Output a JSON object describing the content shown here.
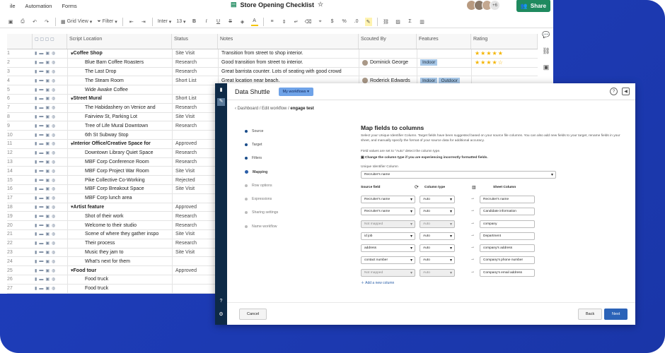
{
  "menu": {
    "items": [
      "ile",
      "Automation",
      "Forms"
    ]
  },
  "sheet": {
    "title": "Store Opening Checklist",
    "share": "Share",
    "more_avatars": "+6",
    "toolbar": {
      "grid_view": "Grid View",
      "filter": "Filter",
      "font": "Inter",
      "size": "13"
    },
    "columns": {
      "script": "Script Location",
      "status": "Status",
      "notes": "Notes",
      "scouted": "Scouted By",
      "features": "Features",
      "rating": "Rating"
    },
    "rows": [
      {
        "n": "1",
        "name": "Coffee Shop",
        "type": "parent",
        "status": "Site Visit",
        "notes": "Transition from street to shop interior.",
        "scout": "",
        "features": [],
        "rating": "★★★★★"
      },
      {
        "n": "2",
        "name": "Blue Barn Coffee Roasters",
        "type": "child",
        "status": "Research",
        "notes": "Good transition from street to interior.",
        "scout": "Dominick George",
        "features": [
          "Indoor"
        ],
        "rating": "★★★★☆"
      },
      {
        "n": "3",
        "name": "The Last Drop",
        "type": "child",
        "status": "Research",
        "notes": "Great barrista counter. Lots of seating with good crowd",
        "scout": "",
        "features": [],
        "rating": ""
      },
      {
        "n": "4",
        "name": "The Steam Room",
        "type": "child",
        "status": "Short List",
        "notes": "Great location near beach.",
        "scout": "Roderick Edwards",
        "features": [
          "Indoor",
          "Outdoor"
        ],
        "rating": ""
      },
      {
        "n": "5",
        "name": "Wide Awake Coffee",
        "type": "child",
        "status": "",
        "notes": "",
        "scout": "",
        "features": [],
        "rating": ""
      },
      {
        "n": "6",
        "name": "Street Mural",
        "type": "parent",
        "status": "Short List",
        "notes": "",
        "scout": "",
        "features": [],
        "rating": ""
      },
      {
        "n": "7",
        "name": "The Habidashery on Venice and",
        "type": "child",
        "status": "Research",
        "notes": "",
        "scout": "",
        "features": [],
        "rating": ""
      },
      {
        "n": "8",
        "name": "Fairview St, Parking Lot",
        "type": "child",
        "status": "Site Visit",
        "notes": "",
        "scout": "",
        "features": [],
        "rating": ""
      },
      {
        "n": "9",
        "name": "Tree of Life Mural Downtown",
        "type": "child",
        "status": "Research",
        "notes": "",
        "scout": "",
        "features": [],
        "rating": ""
      },
      {
        "n": "10",
        "name": "6th St Subway Stop",
        "type": "child",
        "status": "",
        "notes": "",
        "scout": "",
        "features": [],
        "rating": ""
      },
      {
        "n": "11",
        "name": "Interior Office/Creative Space for",
        "type": "parent",
        "status": "Approved",
        "notes": "",
        "scout": "",
        "features": [],
        "rating": ""
      },
      {
        "n": "12",
        "name": "Downtown Library Quiet Space",
        "type": "child",
        "status": "Research",
        "notes": "",
        "scout": "",
        "features": [],
        "rating": ""
      },
      {
        "n": "13",
        "name": "MBF Corp Conference Room",
        "type": "child",
        "status": "Research",
        "notes": "",
        "scout": "",
        "features": [],
        "rating": ""
      },
      {
        "n": "14",
        "name": "MBF Corp Project War Room",
        "type": "child",
        "status": "Site Visit",
        "notes": "",
        "scout": "",
        "features": [],
        "rating": ""
      },
      {
        "n": "15",
        "name": "Pike Collective Co-Working",
        "type": "child",
        "status": "Rejected",
        "notes": "",
        "scout": "",
        "features": [],
        "rating": ""
      },
      {
        "n": "16",
        "name": "MBF Corp Breakout Space",
        "type": "child",
        "status": "Site Visit",
        "notes": "",
        "scout": "",
        "features": [],
        "rating": ""
      },
      {
        "n": "17",
        "name": "MBF Corp lunch area",
        "type": "child",
        "status": "",
        "notes": "",
        "scout": "",
        "features": [],
        "rating": ""
      },
      {
        "n": "18",
        "name": "Artist feature",
        "type": "parent",
        "status": "Approved",
        "notes": "",
        "scout": "",
        "features": [],
        "rating": ""
      },
      {
        "n": "19",
        "name": "Shot of their work",
        "type": "child",
        "status": "Research",
        "notes": "",
        "scout": "",
        "features": [],
        "rating": ""
      },
      {
        "n": "20",
        "name": "Welcome to their studio",
        "type": "child",
        "status": "Research",
        "notes": "",
        "scout": "",
        "features": [],
        "rating": ""
      },
      {
        "n": "21",
        "name": "Scene of where they gather inspo",
        "type": "child",
        "status": "Site Visit",
        "notes": "",
        "scout": "",
        "features": [],
        "rating": ""
      },
      {
        "n": "22",
        "name": "Their process",
        "type": "child",
        "status": "Research",
        "notes": "",
        "scout": "",
        "features": [],
        "rating": ""
      },
      {
        "n": "23",
        "name": "Music they jam to",
        "type": "child",
        "status": "Site Visit",
        "notes": "",
        "scout": "",
        "features": [],
        "rating": ""
      },
      {
        "n": "24",
        "name": "What's next for them",
        "type": "child",
        "status": "",
        "notes": "",
        "scout": "",
        "features": [],
        "rating": ""
      },
      {
        "n": "25",
        "name": "Food tour",
        "type": "parent",
        "status": "Approved",
        "notes": "",
        "scout": "",
        "features": [],
        "rating": ""
      },
      {
        "n": "26",
        "name": "Food truck",
        "type": "child",
        "status": "",
        "notes": "",
        "scout": "",
        "features": [],
        "rating": ""
      },
      {
        "n": "27",
        "name": "Food truck",
        "type": "child",
        "status": "",
        "notes": "",
        "scout": "",
        "features": [],
        "rating": ""
      }
    ]
  },
  "modal": {
    "app": "Data Shuttle",
    "workflows": "My workflows",
    "crumb": {
      "a": "Dashboard",
      "b": "Edit workflow",
      "c": "engage test"
    },
    "steps": [
      {
        "label": "Source",
        "state": "done"
      },
      {
        "label": "Target",
        "state": "done"
      },
      {
        "label": "Filters",
        "state": "done"
      },
      {
        "label": "Mapping",
        "state": "current"
      },
      {
        "label": "Row options",
        "state": "off"
      },
      {
        "label": "Expressions",
        "state": "off"
      },
      {
        "label": "Sharing settings",
        "state": "off"
      },
      {
        "label": "Name workflow",
        "state": "off"
      }
    ],
    "heading": "Map fields to columns",
    "desc": "Select your Unique Identifier Column. Target fields have been suggested based on your source file columns. You can also add new fields to your target, rename fields in your sheet, and manually specify the format of your source data for additional accuracy.",
    "note1": "Field values are set to \"Auto\" detect the column type.",
    "note2": "Change the column type if you are experiencing incorrectly formatted fields.",
    "uid_label": "Unique Identifier Column",
    "uid_value": "Recruiter's name",
    "col_source": "Source field",
    "col_type": "Column type",
    "col_sheet": "Sheet Column",
    "maps": [
      {
        "src": "Recruiter's name",
        "type": "Auto",
        "dis": false,
        "sheet": "Recruiter's name"
      },
      {
        "src": "Recruiter's name",
        "type": "Auto",
        "dis": false,
        "sheet": "Candidate information"
      },
      {
        "src": "Not mapped",
        "type": "Auto",
        "dis": true,
        "sheet": "company"
      },
      {
        "src": "id job",
        "type": "Auto",
        "dis": false,
        "sheet": "Department"
      },
      {
        "src": "address",
        "type": "Auto",
        "dis": false,
        "sheet": "company's address"
      },
      {
        "src": "contact number",
        "type": "Auto",
        "dis": false,
        "sheet": "Company's phone number"
      },
      {
        "src": "Not mapped",
        "type": "Auto",
        "dis": true,
        "sheet": "Company's email address"
      }
    ],
    "add_col": "Add a new column",
    "cancel": "Cancel",
    "back": "Back",
    "next": "Next"
  }
}
